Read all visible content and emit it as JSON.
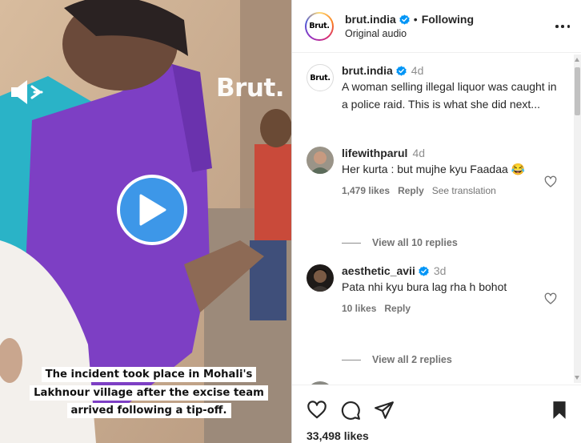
{
  "video": {
    "watermark": "Brut.",
    "caption_lines": [
      "The incident took place in Mohali's",
      "Lakhnour village after the excise team",
      "arrived following a tip-off."
    ],
    "icons": {
      "mute": "volume-muted-icon",
      "play": "play-icon"
    },
    "play_button_color": "#3d97e8"
  },
  "header": {
    "username": "brut.india",
    "logo_text": "Brut.",
    "separator": "•",
    "follow_status": "Following",
    "audio": "Original audio",
    "more_icon": "more-options-icon"
  },
  "caption": {
    "username": "brut.india",
    "age": "4d",
    "text": "A woman selling illegal liquor was caught in a police raid. This is what she did next..."
  },
  "comments": [
    {
      "username": "lifewithparul",
      "age": "4d",
      "text": "Her kurta : but mujhe kyu Faadaa 😂",
      "likes": "1,479 likes",
      "reply": "Reply",
      "translate": "See translation",
      "view_replies": "View all 10 replies"
    },
    {
      "username": "aesthetic_avii",
      "age": "3d",
      "verified": true,
      "text": "Pata nhi kyu bura lag rha h bohot",
      "likes": "10 likes",
      "reply": "Reply",
      "view_replies": "View all 2 replies"
    }
  ],
  "footer": {
    "likes": "33,498 likes",
    "icons": [
      "heart-icon",
      "comment-icon",
      "share-icon",
      "bookmark-icon"
    ]
  },
  "colors": {
    "verified": "#0095f6",
    "text": "#262626",
    "muted": "#737373"
  }
}
